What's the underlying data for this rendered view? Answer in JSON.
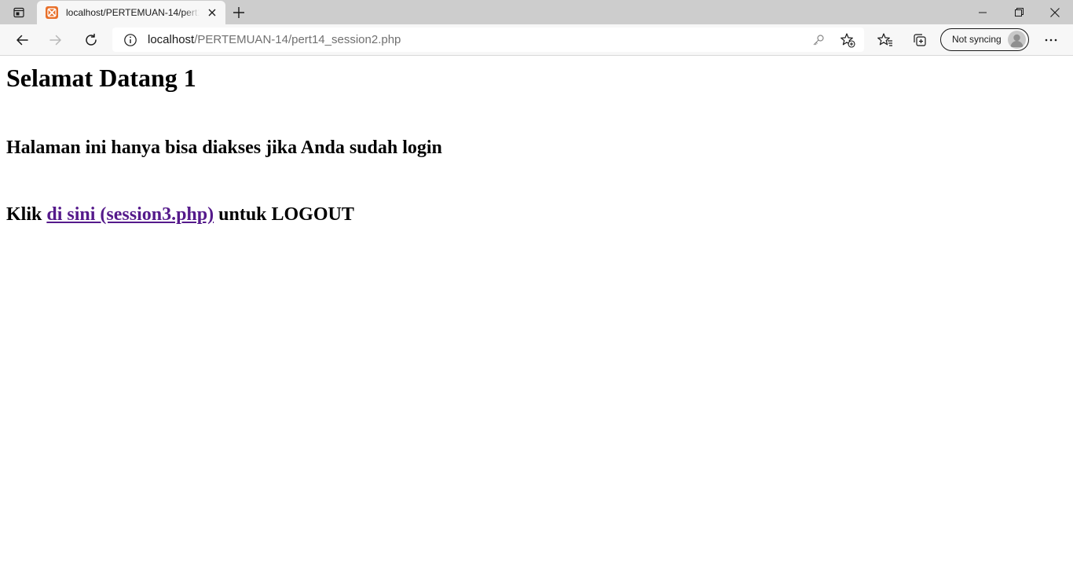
{
  "browser": {
    "tab": {
      "title": "localhost/PERTEMUAN-14/pert14_session2.php",
      "favicon": "xampp-icon"
    },
    "address_bar": {
      "url_host": "localhost",
      "url_path": "/PERTEMUAN-14/pert14_session2.php"
    },
    "profile": {
      "label": "Not syncing"
    },
    "icons": {
      "tab_actions": "tab-actions-icon",
      "close_tab": "close-icon",
      "new_tab": "plus-icon",
      "minimize": "minimize-icon",
      "restore": "restore-icon",
      "close_window": "close-icon",
      "back": "back-arrow-icon",
      "forward": "forward-arrow-icon",
      "refresh": "refresh-icon",
      "site_info": "info-icon",
      "password_key": "key-icon",
      "add_favorite": "star-plus-icon",
      "favorites": "favorites-icon",
      "collections": "collections-icon",
      "menu": "more-icon"
    },
    "colors": {
      "tabstrip": "#cdcdcd",
      "toolbar": "#f7f7f7",
      "favicon": "#e8702a",
      "link_visited": "#551a8b"
    }
  },
  "page": {
    "heading": "Selamat Datang 1",
    "notice": "Halaman ini hanya bisa diakses jika Anda sudah login",
    "logout_prefix": "Klik",
    "logout_link": "di sini (session3.php)",
    "logout_suffix": "untuk LOGOUT"
  }
}
